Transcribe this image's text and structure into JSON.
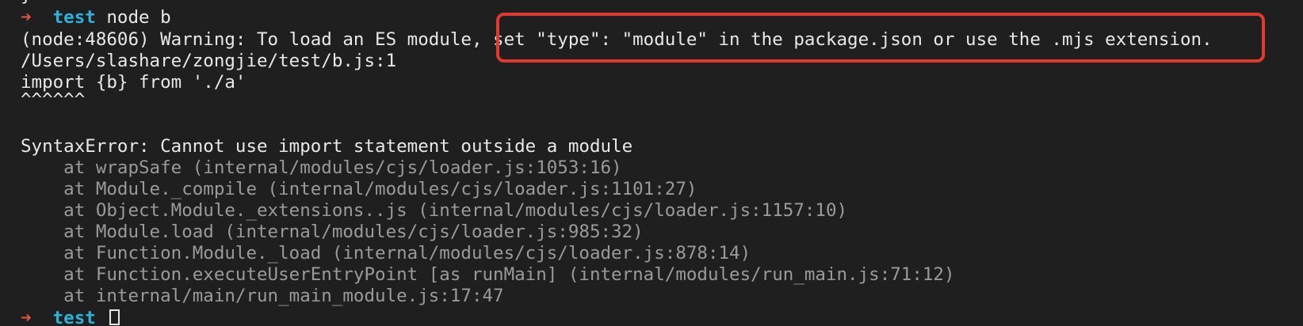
{
  "prompt": {
    "arrow": "➜",
    "dir": "test",
    "command": "node b"
  },
  "lines": {
    "warning": "(node:48606) Warning: To load an ES module, set \"type\": \"module\" in the package.json or use the .mjs extension.",
    "file_ref": "/Users/slashare/zongjie/test/b.js:1",
    "source": "import {b} from './a'",
    "caret": "^^^^^^",
    "error": "SyntaxError: Cannot use import statement outside a module"
  },
  "stack": [
    "    at wrapSafe (internal/modules/cjs/loader.js:1053:16)",
    "    at Module._compile (internal/modules/cjs/loader.js:1101:27)",
    "    at Object.Module._extensions..js (internal/modules/cjs/loader.js:1157:10)",
    "    at Module.load (internal/modules/cjs/loader.js:985:32)",
    "    at Function.Module._load (internal/modules/cjs/loader.js:878:14)",
    "    at Function.executeUserEntryPoint [as runMain] (internal/modules/run_main.js:71:12)",
    "    at internal/main/run_main_module.js:17:47"
  ],
  "prompt_bottom": {
    "arrow": "➜",
    "dir": "test"
  },
  "top_cut_text": "}",
  "colors": {
    "background": "#1f1f1f",
    "prompt_arrow": "#e0533f",
    "prompt_dir": "#2bb3d9",
    "highlight_border": "#e03a2e",
    "stack_text": "#9a9a9a"
  }
}
